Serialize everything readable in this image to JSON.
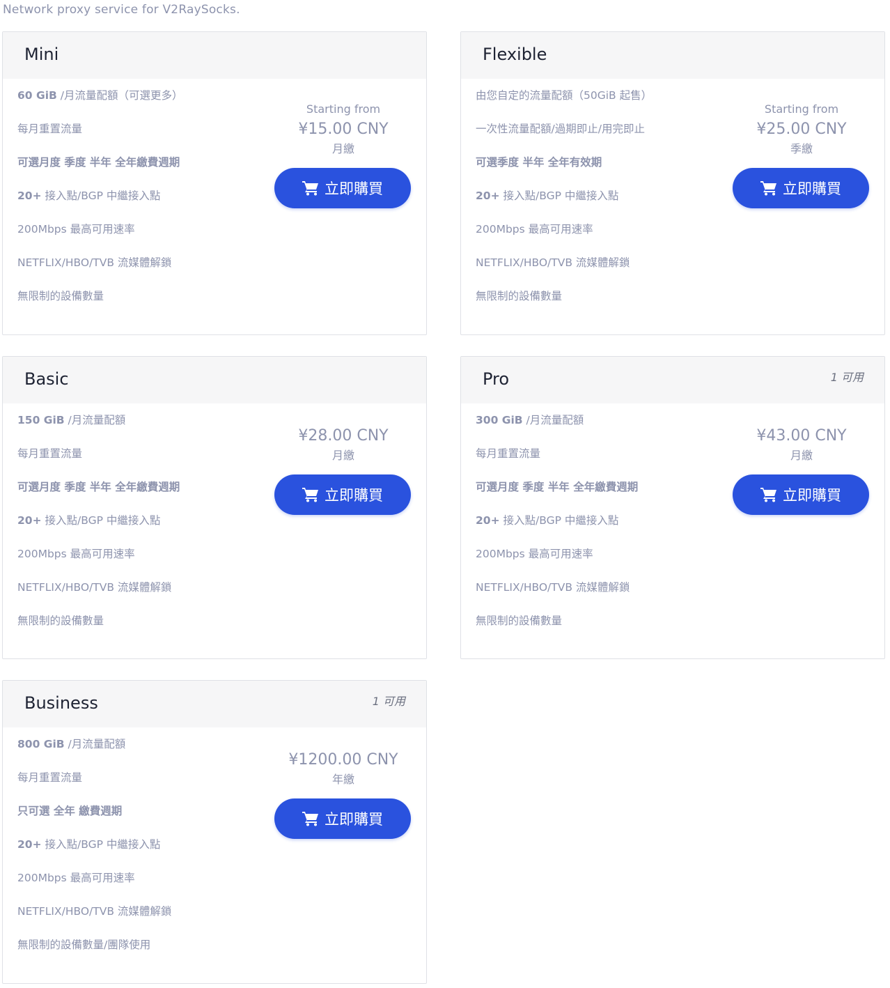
{
  "subtitle": "Network proxy service for V2RaySocks.",
  "buy_label": "立即購買",
  "plans": [
    {
      "name": "Mini",
      "available": "",
      "starting_from": "Starting from",
      "price": "¥15.00 CNY",
      "cycle": "月繳",
      "features": [
        {
          "hl": "60 GiB",
          "text": " /月流量配額（可選更多）"
        },
        {
          "hl": "",
          "text": "每月重置流量"
        },
        {
          "hl": "可選月度 季度 半年 全年繳費週期",
          "text": ""
        },
        {
          "hl": "20+",
          "text": " 接入點/BGP 中繼接入點"
        },
        {
          "hl": "",
          "text": "200Mbps 最高可用速率"
        },
        {
          "hl": "",
          "text": "NETFLIX/HBO/TVB 流媒體解鎖"
        },
        {
          "hl": "",
          "text": "無限制的設備數量"
        }
      ]
    },
    {
      "name": "Flexible",
      "available": "",
      "starting_from": "Starting from",
      "price": "¥25.00 CNY",
      "cycle": "季繳",
      "features": [
        {
          "hl": "",
          "text": "由您自定的流量配額（50GiB 起售）"
        },
        {
          "hl": "",
          "text": "一次性流量配額/過期即止/用完即止"
        },
        {
          "hl": "可選季度 半年 全年有效期",
          "text": ""
        },
        {
          "hl": "20+",
          "text": " 接入點/BGP 中繼接入點"
        },
        {
          "hl": "",
          "text": "200Mbps 最高可用速率"
        },
        {
          "hl": "",
          "text": "NETFLIX/HBO/TVB 流媒體解鎖"
        },
        {
          "hl": "",
          "text": "無限制的設備數量"
        }
      ]
    },
    {
      "name": "Basic",
      "available": "",
      "starting_from": "",
      "price": "¥28.00 CNY",
      "cycle": "月繳",
      "features": [
        {
          "hl": "150 GiB",
          "text": " /月流量配額"
        },
        {
          "hl": "",
          "text": "每月重置流量"
        },
        {
          "hl": "可選月度 季度 半年 全年繳費週期",
          "text": ""
        },
        {
          "hl": "20+",
          "text": " 接入點/BGP 中繼接入點"
        },
        {
          "hl": "",
          "text": "200Mbps 最高可用速率"
        },
        {
          "hl": "",
          "text": "NETFLIX/HBO/TVB 流媒體解鎖"
        },
        {
          "hl": "",
          "text": "無限制的設備數量"
        }
      ]
    },
    {
      "name": "Pro",
      "available": "1 可用",
      "starting_from": "",
      "price": "¥43.00 CNY",
      "cycle": "月繳",
      "features": [
        {
          "hl": "300 GiB",
          "text": " /月流量配額"
        },
        {
          "hl": "",
          "text": "每月重置流量"
        },
        {
          "hl": "可選月度 季度 半年 全年繳費週期",
          "text": ""
        },
        {
          "hl": "20+",
          "text": " 接入點/BGP 中繼接入點"
        },
        {
          "hl": "",
          "text": "200Mbps 最高可用速率"
        },
        {
          "hl": "",
          "text": "NETFLIX/HBO/TVB 流媒體解鎖"
        },
        {
          "hl": "",
          "text": "無限制的設備數量"
        }
      ]
    },
    {
      "name": "Business",
      "available": "1 可用",
      "starting_from": "",
      "price": "¥1200.00 CNY",
      "cycle": "年繳",
      "features": [
        {
          "hl": "800 GiB",
          "text": " /月流量配額"
        },
        {
          "hl": "",
          "text": "每月重置流量"
        },
        {
          "hl": "只可選 全年 繳費週期",
          "text": ""
        },
        {
          "hl": "20+",
          "text": " 接入點/BGP 中繼接入點"
        },
        {
          "hl": "",
          "text": "200Mbps 最高可用速率"
        },
        {
          "hl": "",
          "text": "NETFLIX/HBO/TVB 流媒體解鎖"
        },
        {
          "hl": "",
          "text": "無限制的設備數量/團隊使用"
        }
      ]
    }
  ]
}
